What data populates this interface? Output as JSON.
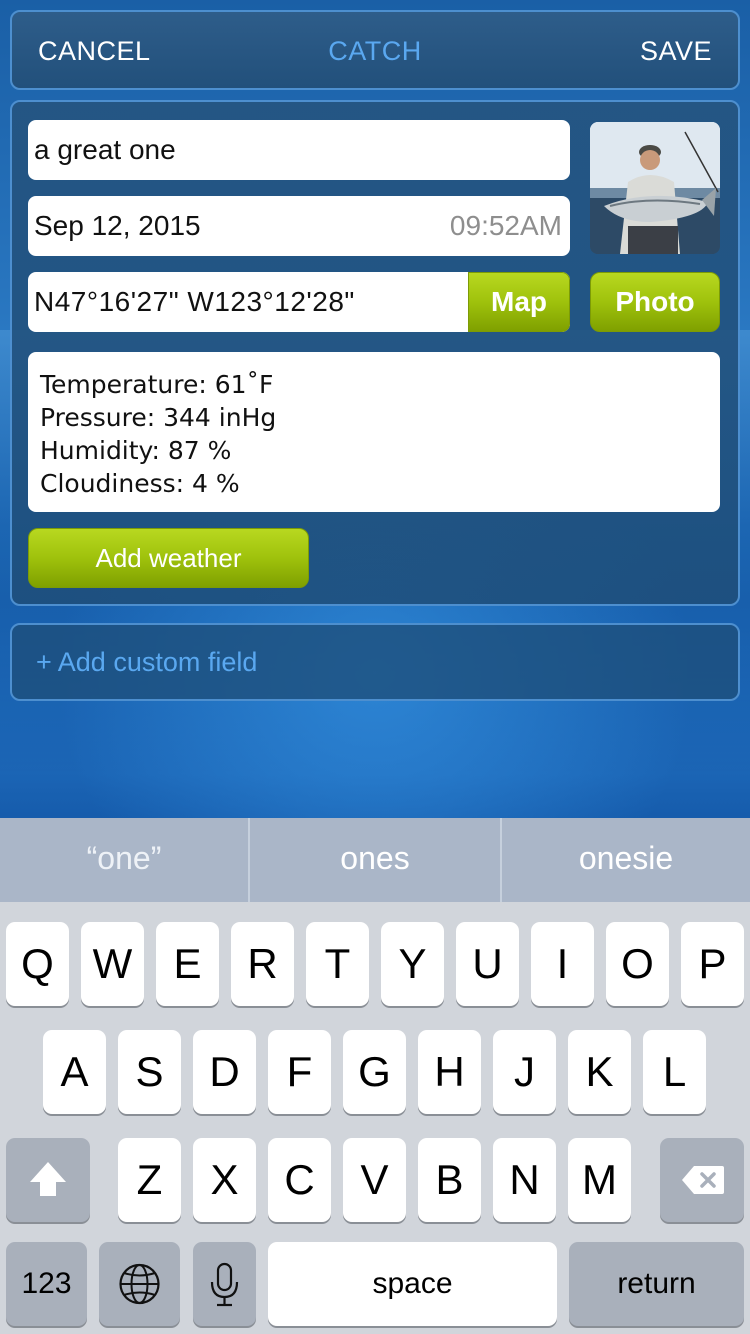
{
  "header": {
    "cancel_label": "CANCEL",
    "title": "CATCH",
    "save_label": "SAVE"
  },
  "form": {
    "title_value": "a great one",
    "date_value": "Sep 12, 2015",
    "time_value": "09:52AM",
    "coords_value": "N47°16'27\" W123°12'28\"",
    "map_label": "Map",
    "photo_label": "Photo",
    "weather_lines": [
      "Temperature: 61˚F",
      "Pressure: 344 inHg",
      "Humidity: 87 %",
      "Cloudiness: 4 %"
    ],
    "add_weather_label": "Add weather",
    "add_custom_field_label": "+ Add custom field"
  },
  "keyboard": {
    "suggestions": [
      "“one”",
      "ones",
      "onesie"
    ],
    "row1": [
      "Q",
      "W",
      "E",
      "R",
      "T",
      "Y",
      "U",
      "I",
      "O",
      "P"
    ],
    "row2": [
      "A",
      "S",
      "D",
      "F",
      "G",
      "H",
      "J",
      "K",
      "L"
    ],
    "row3": [
      "Z",
      "X",
      "C",
      "V",
      "B",
      "N",
      "M"
    ],
    "numbers_label": "123",
    "space_label": "space",
    "return_label": "return"
  },
  "colors": {
    "accent_blue": "#5aa8f0",
    "green_button": "#9fc20c",
    "panel_border": "#4d8fcf"
  }
}
